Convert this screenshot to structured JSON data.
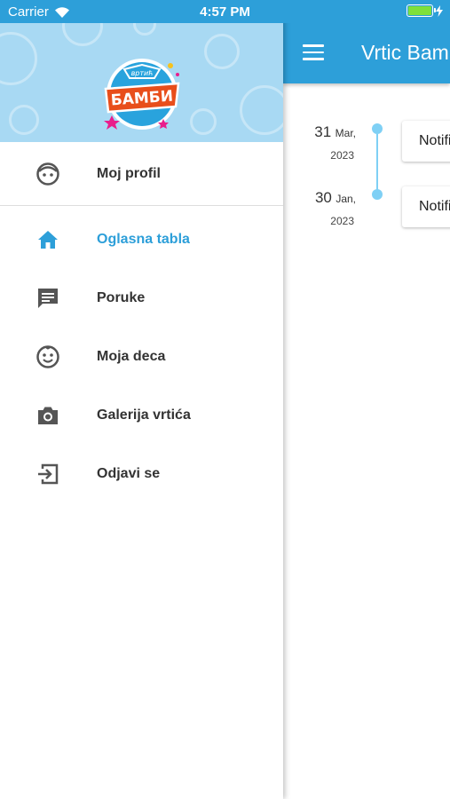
{
  "status": {
    "carrier": "Carrier",
    "time": "4:57 PM"
  },
  "appbar": {
    "title": "Vrtic Bambi"
  },
  "timeline": [
    {
      "day": "31",
      "month": "Mar,",
      "year": "2023",
      "card_label": "Notifikacija"
    },
    {
      "day": "30",
      "month": "Jan,",
      "year": "2023",
      "card_label": "Notifikacija"
    }
  ],
  "drawer": {
    "logo": {
      "top_text": "вртић",
      "main_text": "БАМБИ"
    },
    "profile": {
      "label": "Moj profil",
      "icon": "face-icon"
    },
    "items": [
      {
        "label": "Oglasna tabla",
        "icon": "home-icon",
        "active": true
      },
      {
        "label": "Poruke",
        "icon": "message-icon",
        "active": false
      },
      {
        "label": "Moja deca",
        "icon": "child-face-icon",
        "active": false
      },
      {
        "label": "Galerija vrtića",
        "icon": "camera-icon",
        "active": false
      },
      {
        "label": "Odjavi se",
        "icon": "logout-icon",
        "active": false
      }
    ]
  },
  "colors": {
    "primary": "#2d9fd9",
    "header_bg": "#a8d9f3",
    "timeline": "#7fd0f5",
    "battery": "#7ee03c"
  }
}
